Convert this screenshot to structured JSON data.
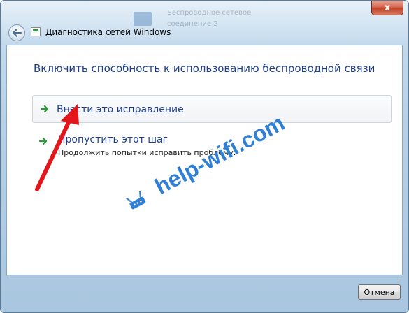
{
  "window": {
    "title": "Диагностика сетей Windows",
    "close_symbol": "x",
    "background_text": [
      "Беспроводное сетевое",
      "соединение 2"
    ]
  },
  "content": {
    "heading": "Включить способность к использованию беспроводной связи",
    "options": [
      {
        "label": "Внести это исправление",
        "description": ""
      },
      {
        "label": "Пропустить этот шаг",
        "description": "Продолжить попытки исправить проблему."
      }
    ]
  },
  "footer": {
    "cancel_label": "Отмена"
  },
  "watermark": {
    "text": "help-wifi.com",
    "color": "#2f7fd6"
  },
  "colors": {
    "link": "#1e3f8f",
    "arrow": "#2c9a3a",
    "annotation_arrow": "#e3161b"
  },
  "icons": [
    "back-arrow-icon",
    "network-diagnostics-icon",
    "close-icon",
    "green-arrow-icon",
    "router-icon"
  ]
}
